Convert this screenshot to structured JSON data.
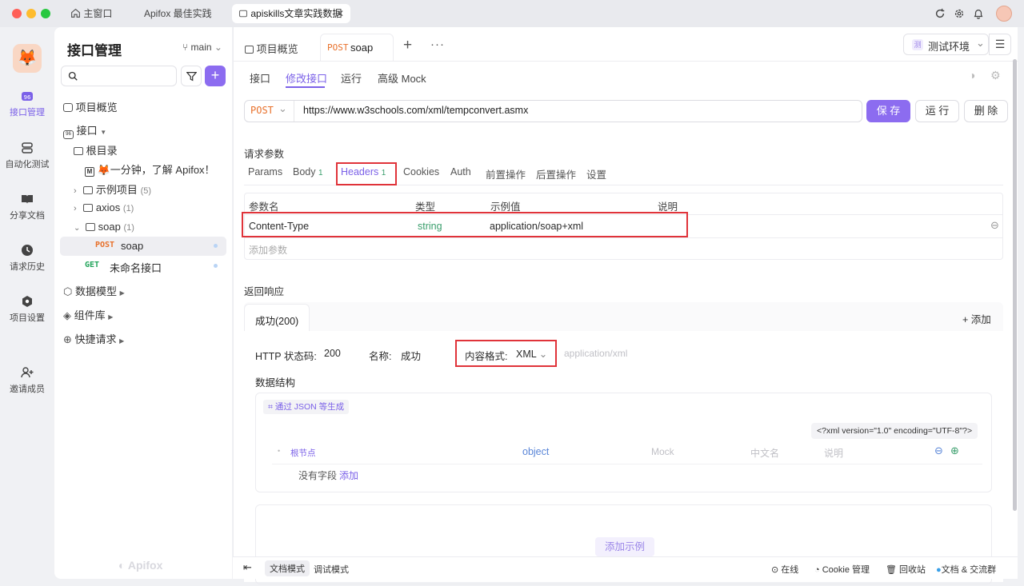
{
  "titlebar": {
    "tabs": [
      "主窗口",
      "Apifox 最佳实践",
      "apiskills文章实践数据"
    ]
  },
  "rail": {
    "items": [
      "接口管理",
      "自动化测试",
      "分享文档",
      "请求历史",
      "项目设置",
      "邀请成员"
    ]
  },
  "sidebar": {
    "title": "接口管理",
    "branch": "main",
    "items": {
      "overview": "项目概览",
      "api": "接口",
      "root": "根目录",
      "intro": "🦊一分钟，了解 Apifox！",
      "examples": "示例项目",
      "examples_count": "(5)",
      "axios": "axios",
      "axios_count": "(1)",
      "soap": "soap",
      "soap_count": "(1)",
      "soap_method": "POST",
      "soap_name": "soap",
      "get_method": "GET",
      "get_name": "未命名接口",
      "models": "数据模型",
      "components": "组件库",
      "quick": "快捷请求"
    },
    "brand": "Apifox"
  },
  "main": {
    "tabs": {
      "overview": "项目概览",
      "method": "POST",
      "name": "soap"
    },
    "env": "测试环境",
    "env_badge": "测",
    "subtabs": [
      "接口",
      "修改接口",
      "运行",
      "高级 Mock"
    ],
    "url_method": "POST",
    "url": "https://www.w3schools.com/xml/tempconvert.asmx",
    "save": "保 存",
    "run": "运 行",
    "delete": "删 除",
    "req_title": "请求参数",
    "param_tabs": [
      "Params",
      "Body",
      "Headers",
      "Cookies",
      "Auth",
      "前置操作",
      "后置操作",
      "设置"
    ],
    "body_count": "1",
    "headers_count": "1",
    "columns": [
      "参数名",
      "类型",
      "示例值",
      "说明"
    ],
    "row": {
      "name": "Content-Type",
      "type": "string",
      "example": "application/soap+xml"
    },
    "add_param": "添加参数",
    "resp_title": "返回响应",
    "resp_tab": "成功(200)",
    "resp_add": "添加",
    "http_label": "HTTP 状态码:",
    "http_code": "200",
    "name_label": "名称:",
    "name_val": "成功",
    "ct_label": "内容格式:",
    "ct_val": "XML",
    "ct_mime": "application/xml",
    "struct_title": "数据结构",
    "gen_json": "通过 JSON 等生成",
    "xml_decl": "<?xml version=\"1.0\" encoding=\"UTF-8\"?>",
    "root_node": "根节点",
    "object": "object",
    "mock": "Mock",
    "cn_name": "中文名",
    "desc": "说明",
    "no_field": "没有字段",
    "no_field_add": "添加",
    "add_example": "添加示例"
  },
  "footer": {
    "doc_mode": "文档模式",
    "debug_mode": "调试模式",
    "online": "在线",
    "cookie": "Cookie 管理",
    "trash": "回收站",
    "docs": "文档 & 交流群"
  },
  "colors": {
    "accent": "#7b61e8",
    "post": "#e8702a",
    "get": "#22a45a",
    "red": "#e0333a"
  }
}
